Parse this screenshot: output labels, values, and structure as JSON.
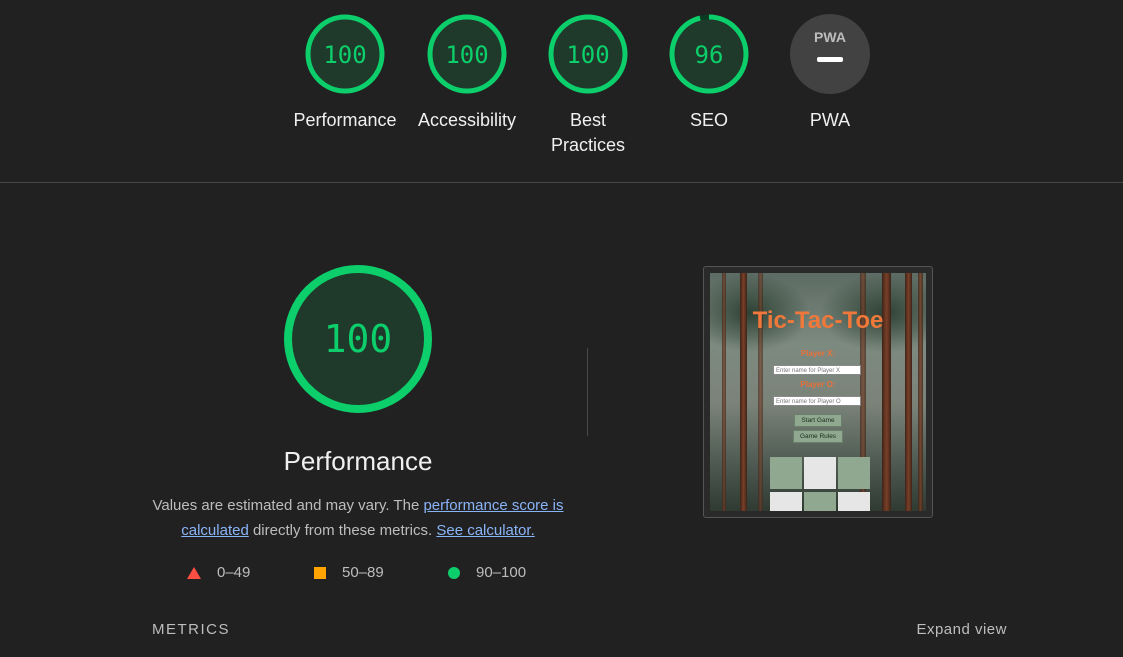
{
  "top_scores": [
    {
      "score": "100",
      "label": "Performance",
      "value": 100
    },
    {
      "score": "100",
      "label": "Accessibility",
      "value": 100
    },
    {
      "score": "100",
      "label": "Best Practices",
      "value": 100
    },
    {
      "score": "96",
      "label": "SEO",
      "value": 96
    },
    {
      "score": "PWA",
      "label": "PWA"
    }
  ],
  "main": {
    "score": "100",
    "title": "Performance",
    "desc_1": "Values are estimated and may vary. The ",
    "link_score": "performance score is calculated",
    "desc_2": " directly from these metrics. ",
    "link_calc": "See calculator.",
    "legend": [
      "0–49",
      "50–89",
      "90–100"
    ]
  },
  "thumbnail": {
    "title": "Tic-Tac-Toe",
    "player_x_label": "Player X:",
    "player_x_placeholder": "Enter name for Player X",
    "player_o_label": "Player O:",
    "player_o_placeholder": "Enter name for Player O",
    "start_button": "Start Game",
    "rules_button": "Game Rules"
  },
  "footer": {
    "metrics": "METRICS",
    "expand": "Expand view"
  },
  "colors": {
    "pass": "#0cce6b",
    "average": "#ffa400",
    "fail": "#ff4e42",
    "link": "#8ab4f8"
  }
}
